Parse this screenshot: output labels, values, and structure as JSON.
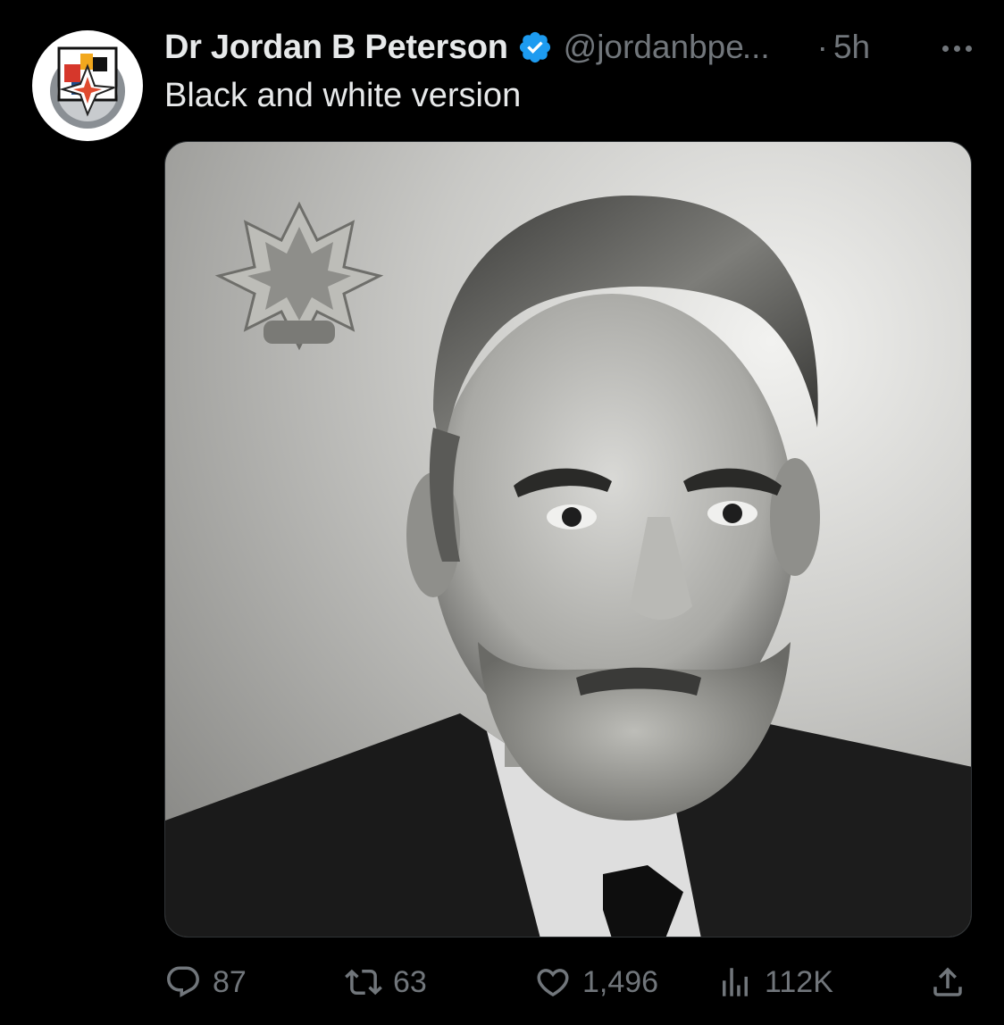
{
  "tweet": {
    "author_name": "Dr Jordan B Peterson",
    "handle": "@jordanbpe",
    "handle_ellipsis": "...",
    "separator": "·",
    "time": "5h",
    "text": "Black and white version",
    "verified_color": "#1d9bf0",
    "media": {
      "description_icon": "portrait-photo",
      "style": "grayscale"
    },
    "stats": {
      "replies": "87",
      "retweets": "63",
      "likes": "1,496",
      "views": "112K"
    },
    "icons": {
      "reply": "speech-bubble-icon",
      "retweet": "retweet-arrows-icon",
      "like": "heart-icon",
      "views": "bar-chart-icon",
      "share": "share-upload-icon",
      "more": "more-dots-icon"
    }
  },
  "colors": {
    "background": "#000000",
    "primary_text": "#e7e9ea",
    "secondary_text": "#71767b",
    "accent": "#1d9bf0"
  }
}
